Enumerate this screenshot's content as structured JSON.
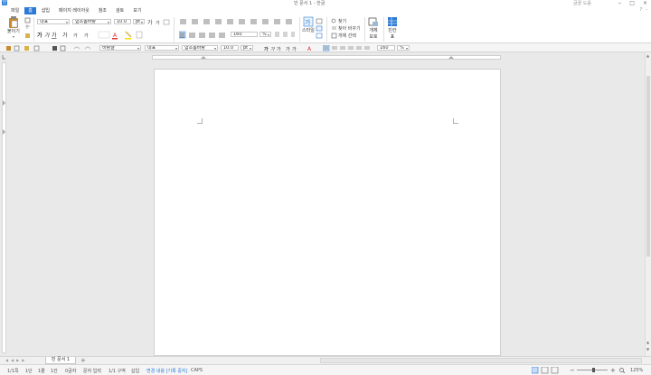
{
  "app": {
    "logo_text": "한",
    "title": "빈 문서 1 - 한글",
    "help": "글꼴 도움",
    "controls": [
      "‒",
      "□",
      "×"
    ]
  },
  "menu": {
    "items": [
      "파일",
      "홈",
      "삽입",
      "페이지 레이아웃",
      "참조",
      "검토",
      "보기"
    ],
    "right": [
      "?",
      "-"
    ]
  },
  "ribbon": {
    "paste_label": "붙이기",
    "style_field": "대표",
    "font_field": "함초롬바탕",
    "size_field": "10.0",
    "size_unit": "pt",
    "line_spacing": "160",
    "percent": "%",
    "style_label": "스타일",
    "find_label": "찾기",
    "replace_label": "찾아 바꾸기",
    "select_label": "개체 선택",
    "object_label": "개체",
    "object_sub": "보호",
    "shape_label": "빈칸",
    "shape_sub": "표"
  },
  "toolbar2": {
    "font_lang": "바탕글",
    "style_field": "대표",
    "font_field": "함초롬바탕",
    "size_field": "10.0",
    "size_unit": "pt",
    "spacing": "160",
    "percent": "%"
  },
  "tabs": {
    "doc_tab": "빈 문서 1",
    "add": "+"
  },
  "status": {
    "items": [
      "1/1쪽",
      "1단",
      "1줄",
      "1칸",
      "0글자",
      "문자 입력",
      "1/1 구역",
      "삽입",
      "변경 내용 [기록 중지]",
      "CAPS"
    ],
    "zoom": "125%"
  },
  "colors": {
    "accent": "#2b7bd6"
  }
}
